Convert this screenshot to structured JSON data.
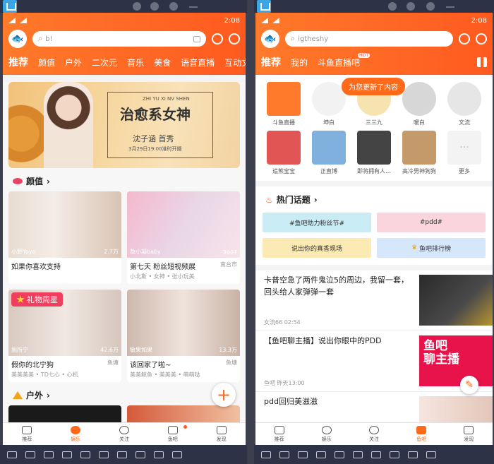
{
  "left": {
    "status_time": "2:08",
    "search_text": "b!",
    "tabs": [
      "推荐",
      "颜值",
      "户外",
      "二次元",
      "音乐",
      "美食",
      "语音直播",
      "互动文"
    ],
    "banner": {
      "title": "治愈系女神",
      "subtitle": "沈子涵 首秀",
      "small_text": "3月29日19:00准时开播",
      "tiny_text": "ZHI YU XI NV SHEN"
    },
    "section1": "颜值",
    "section2": "户外",
    "cards": [
      {
        "name": "小野Yoyo",
        "pop": "2.7万",
        "title": "如果你喜欢支持",
        "city": "",
        "sub": ""
      },
      {
        "name": "敖小凝baby",
        "pop": "3607",
        "title": "第七天 粉丝短视频展",
        "city": "南台市",
        "sub": "小北斯 • 女神 • 张小玩美"
      },
      {
        "name": "厕所宁",
        "pop": "42.6万",
        "title": "假你的北宁狗",
        "city": "鱼塘",
        "sub": "美美美美 • TD七心 • 心机"
      },
      {
        "name": "敏果如果",
        "pop": "13.3万",
        "title": "该回家了啦~",
        "city": "鱼塘",
        "sub": "美美鲸鱼 • 美美美 • 萌萌哒"
      }
    ],
    "gift_badge": "礼物周星",
    "fab": "+",
    "nav": [
      "推荐",
      "娱乐",
      "关注",
      "鱼吧",
      "发现"
    ]
  },
  "right": {
    "status_time": "2:08",
    "search_text": "igtheshy",
    "tabs": [
      "推荐",
      "我的",
      "斗鱼直播吧"
    ],
    "hot_badge": "HOT",
    "toast": "为您更新了内容",
    "avatars": [
      "斗鱼直播",
      "坤白",
      "三三九",
      "暖白",
      "文流",
      "追熊宝宝",
      "正直博",
      "即将拥有人…",
      "高冷男神狗狗",
      "更多"
    ],
    "hot_title": "热门话题",
    "topics": [
      "#鱼吧助力粉丝节#",
      "#pdd#",
      "说出你的真香现场",
      "鱼吧排行榜"
    ],
    "news": [
      {
        "title": "卡普空急了两件鬼泣5的周边，我留一套，回头给人家弹弹一套",
        "meta": "女流66   02:54"
      },
      {
        "title": "【鱼吧聊主播】说出你眼中的PDD",
        "meta": "鱼吧   昨天13:00",
        "img_text": "鱼吧\n聊主播"
      },
      {
        "title": "pdd回归美滋滋",
        "meta": ""
      }
    ],
    "nav": [
      "推荐",
      "娱乐",
      "关注",
      "鱼吧",
      "发现"
    ]
  },
  "colors": {
    "accent": "#ff6a1a",
    "emulator": "#2d3246"
  }
}
